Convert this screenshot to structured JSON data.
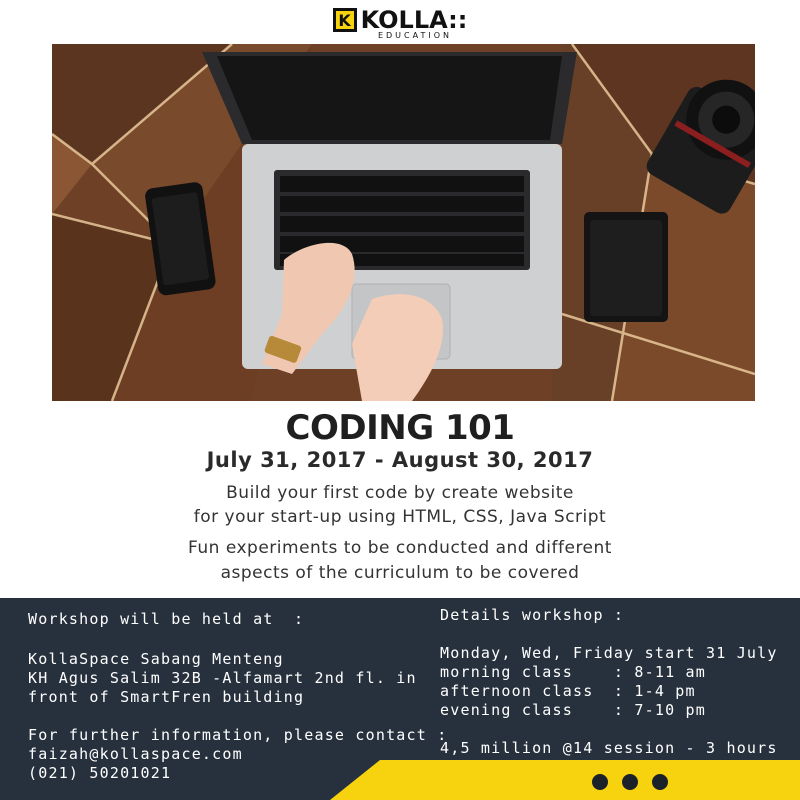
{
  "brand": {
    "logo_mark": "K",
    "name": "KOLLA::",
    "subtitle": "EDUCATION",
    "accent_color": "#f6d20f"
  },
  "hero_image": {
    "icon": "laptop-desk-photo"
  },
  "headline": "CODING 101",
  "dates": "July 31, 2017 - August 30, 2017",
  "description": [
    "Build your first code by create website",
    "for your start-up using HTML, CSS, Java Script",
    "Fun experiments to be conducted and different",
    "aspects of the curriculum to be covered"
  ],
  "venue": {
    "heading": "Workshop will be held at  :",
    "name": "KollaSpace Sabang Menteng",
    "address_line1": "KH Agus Salim 32B -Alfamart 2nd fl. in",
    "address_line2": "front of SmartFren building",
    "contact_heading": "For further information, please contact :",
    "email": "faizah@kollaspace.com",
    "phone": "(021) 50201021"
  },
  "details": {
    "heading": "Details workshop :",
    "schedule": "Monday, Wed, Friday start 31 July",
    "morning": "morning class    : 8-11 am",
    "afternoon": "afternoon class  : 1-4 pm",
    "evening": "evening class    : 7-10 pm",
    "price": "4,5 million @14 session - 3 hours"
  },
  "colors": {
    "panel_bg": "#27313d",
    "stripe": "#f6d20f"
  }
}
